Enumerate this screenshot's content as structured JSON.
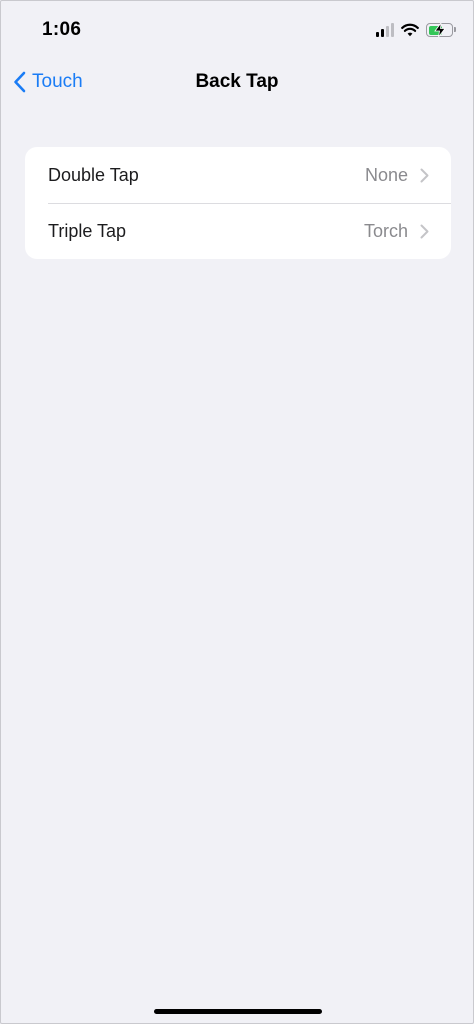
{
  "status_bar": {
    "time": "1:06",
    "icons": [
      "cellular-signal-icon",
      "wifi-icon",
      "battery-charging-icon"
    ],
    "battery_level_fraction": 0.62,
    "battery_color": "#34c759"
  },
  "nav": {
    "back_label": "Touch",
    "title": "Back Tap",
    "accent_color": "#1a7cf5"
  },
  "settings": {
    "rows": [
      {
        "label": "Double Tap",
        "value": "None"
      },
      {
        "label": "Triple Tap",
        "value": "Torch"
      }
    ]
  }
}
